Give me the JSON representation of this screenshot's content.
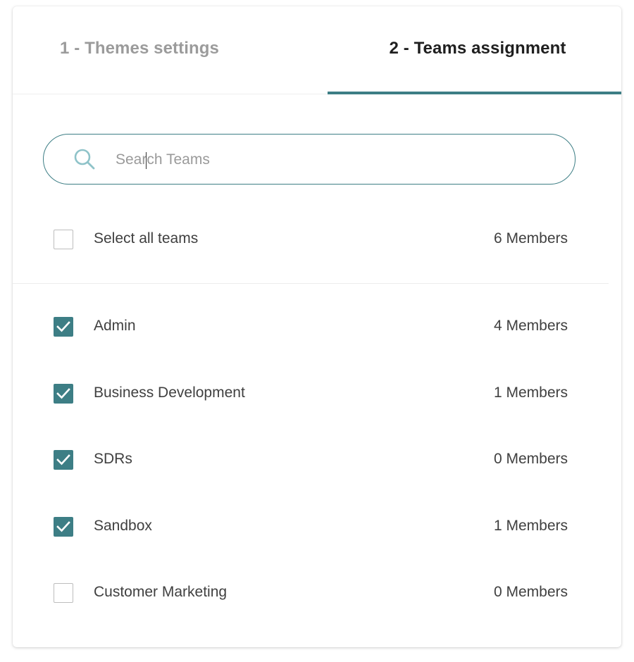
{
  "tabs": [
    {
      "label": "1 - Themes settings",
      "active": false
    },
    {
      "label": "2 - Teams assignment",
      "active": true
    }
  ],
  "search": {
    "placeholder": "Search Teams",
    "value": "",
    "icon": "search-icon"
  },
  "select_all": {
    "label": "Select all teams",
    "count": "6 Members",
    "checked": false
  },
  "teams": [
    {
      "label": "Admin",
      "count": "4 Members",
      "checked": true
    },
    {
      "label": "Business Development",
      "count": "1 Members",
      "checked": true
    },
    {
      "label": "SDRs",
      "count": "0 Members",
      "checked": true
    },
    {
      "label": "Sandbox",
      "count": "1 Members",
      "checked": true
    },
    {
      "label": "Customer Marketing",
      "count": "0 Members",
      "checked": false
    }
  ],
  "colors": {
    "accent": "#3d7e85",
    "search_icon": "#8fc3c9",
    "text": "#404040",
    "tab_inactive": "#9b9b9b"
  }
}
